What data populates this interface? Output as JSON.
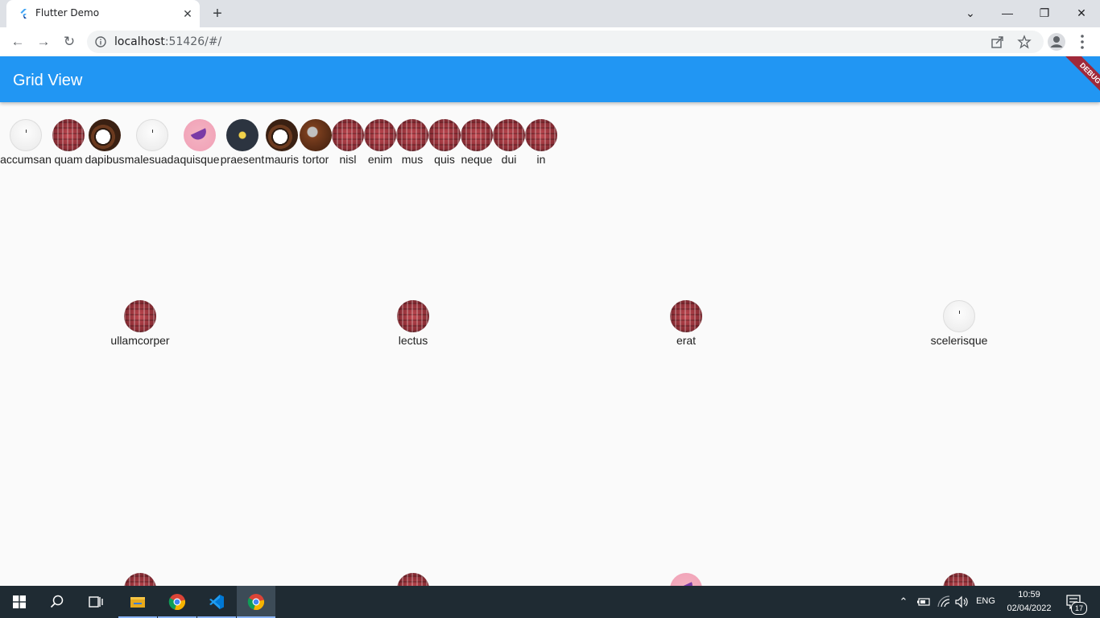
{
  "browser": {
    "tab_title": "Flutter Demo",
    "url_host": "localhost",
    "url_rest": ":51426/#/",
    "new_tab_label": "+",
    "close_tab_label": "✕"
  },
  "app": {
    "title": "Grid View",
    "debug_label": "DEBUG",
    "accent": "#2196f3"
  },
  "top_row": [
    {
      "label": "accumsan",
      "image": "blank"
    },
    {
      "label": "quam",
      "image": "circuit"
    },
    {
      "label": "dapibus",
      "image": "coffee"
    },
    {
      "label": "malesuada",
      "image": "blank"
    },
    {
      "label": "quisque",
      "image": "banana"
    },
    {
      "label": "praesent",
      "image": "board"
    },
    {
      "label": "mauris",
      "image": "coffee"
    },
    {
      "label": "tortor",
      "image": "beans"
    },
    {
      "label": "nisl",
      "image": "circuit"
    },
    {
      "label": "enim",
      "image": "circuit"
    },
    {
      "label": "mus",
      "image": "circuit"
    },
    {
      "label": "quis",
      "image": "circuit"
    },
    {
      "label": "neque",
      "image": "circuit"
    },
    {
      "label": "dui",
      "image": "circuit"
    },
    {
      "label": "in",
      "image": "circuit"
    }
  ],
  "grid": [
    {
      "label": "ullamcorper",
      "image": "circuit"
    },
    {
      "label": "lectus",
      "image": "circuit"
    },
    {
      "label": "erat",
      "image": "circuit"
    },
    {
      "label": "scelerisque",
      "image": "blank"
    }
  ],
  "grid_partial": [
    {
      "image": "circuit"
    },
    {
      "image": "circuit"
    },
    {
      "image": "banana"
    },
    {
      "image": "circuit"
    }
  ],
  "taskbar": {
    "language": "ENG",
    "time": "10:59",
    "date": "02/04/2022",
    "notifications": "17"
  }
}
